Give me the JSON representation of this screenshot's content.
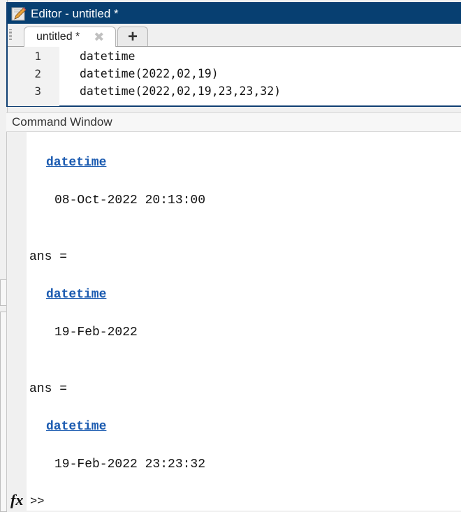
{
  "editor": {
    "window_title": "Editor - untitled *",
    "tabs": [
      {
        "label": "untitled *",
        "close_icon": "close-icon"
      }
    ],
    "add_tab_label": "+",
    "lines": [
      {
        "number": "1",
        "code": "datetime"
      },
      {
        "number": "2",
        "code": "datetime(2022,02,19)"
      },
      {
        "number": "3",
        "code": "datetime(2022,02,19,23,23,32)"
      }
    ]
  },
  "command_window": {
    "title": "Command Window",
    "outputs": [
      {
        "ans": null,
        "type_link": "datetime",
        "value": "08-Oct-2022 20:13:00"
      },
      {
        "ans": "ans =",
        "type_link": "datetime",
        "value": "19-Feb-2022"
      },
      {
        "ans": "ans =",
        "type_link": "datetime",
        "value": "19-Feb-2022 23:23:32"
      }
    ],
    "fx_label": "fx",
    "prompt": ">>"
  },
  "colors": {
    "title_bar": "#073f71",
    "link": "#1a5ab0"
  }
}
